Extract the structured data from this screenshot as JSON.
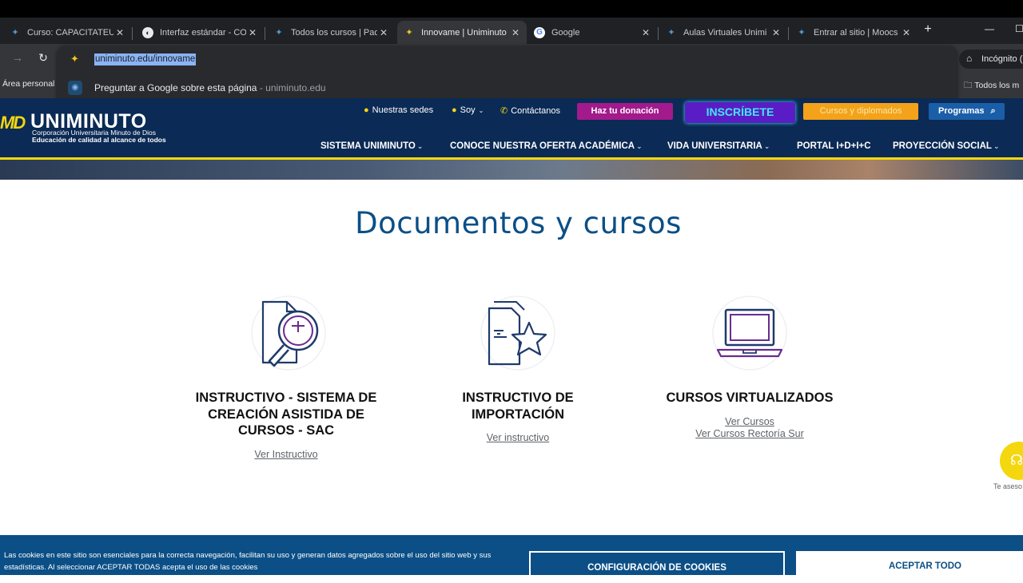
{
  "browser": {
    "tabs": [
      {
        "title": "Curso: CAPACITATEUN",
        "icon": "uniminuto-favicon"
      },
      {
        "title": "Interfaz estándar - CO",
        "icon": "moodle-favicon"
      },
      {
        "title": "Todos los cursos | Pad",
        "icon": "uniminuto-favicon"
      },
      {
        "title": "Innovame | Uniminuto",
        "icon": "uniminuto-favicon",
        "active": true
      },
      {
        "title": "Google",
        "icon": "google-favicon"
      },
      {
        "title": "Aulas Virtuales Unimi",
        "icon": "uniminuto-favicon"
      },
      {
        "title": "Entrar al sitio | Moocs",
        "icon": "uniminuto-favicon"
      }
    ],
    "url": "uniminuto.edu/innovame",
    "suggestion": {
      "text": "Preguntar a Google sobre esta página",
      "domain": "- uniminuto.edu"
    },
    "incognito_label": "Incógnito (",
    "bookmarks": {
      "left": "Área personal |",
      "right": "Todos los m"
    }
  },
  "site": {
    "logo": {
      "mark": "MD",
      "name": "UNIMINUTO",
      "sub1": "Corporación Universitaria Minuto de Dios",
      "sub2": "Educación de calidad al alcance de todos"
    },
    "util_links": {
      "sedes": "Nuestras sedes",
      "soy": "Soy",
      "contacto": "Contáctanos"
    },
    "buttons": {
      "donacion": "Haz tu donación",
      "inscribete": "INSCRÍBETE",
      "cursos": "Cursos y diplomados",
      "programas": "Programas"
    },
    "nav": [
      "SISTEMA UNIMINUTO",
      "CONOCE NUESTRA OFERTA ACADÉMICA",
      "VIDA UNIVERSITARIA",
      "PORTAL I+D+I+C",
      "PROYECCIÓN SOCIAL"
    ]
  },
  "main": {
    "heading": "Documentos y cursos",
    "cards": [
      {
        "title_lines": [
          "INSTRUCTIVO - SISTEMA DE",
          "CREACIÓN ASISTIDA DE",
          "CURSOS - SAC"
        ],
        "links": [
          "Ver Instructivo"
        ],
        "icon": "document-search-icon"
      },
      {
        "title_lines": [
          "INSTRUCTIVO DE",
          "IMPORTACIÓN"
        ],
        "links": [
          "Ver instructivo"
        ],
        "icon": "document-star-icon"
      },
      {
        "title_lines": [
          "CURSOS VIRTUALIZADOS"
        ],
        "links": [
          "Ver Cursos",
          "Ver Cursos Rectoría Sur"
        ],
        "icon": "laptop-icon"
      }
    ]
  },
  "chat": {
    "label": "Te aseso"
  },
  "cookies": {
    "text": "Las cookies en este sitio son esenciales para la correcta navegación, facilitan su uso y generan datos agregados sobre el uso del sitio web y sus estadísticas. Al seleccionar ACEPTAR TODAS acepta el uso de las cookies",
    "config_label": "CONFIGURACIÓN DE COOKIES",
    "accept_label": "ACEPTAR TODO"
  },
  "colors": {
    "header": "#0b2a55",
    "accent_yellow": "#f4d70f",
    "brand_blue": "#0b4f86",
    "donation": "#a21a8c",
    "inscribete": "#5a1dc5"
  }
}
